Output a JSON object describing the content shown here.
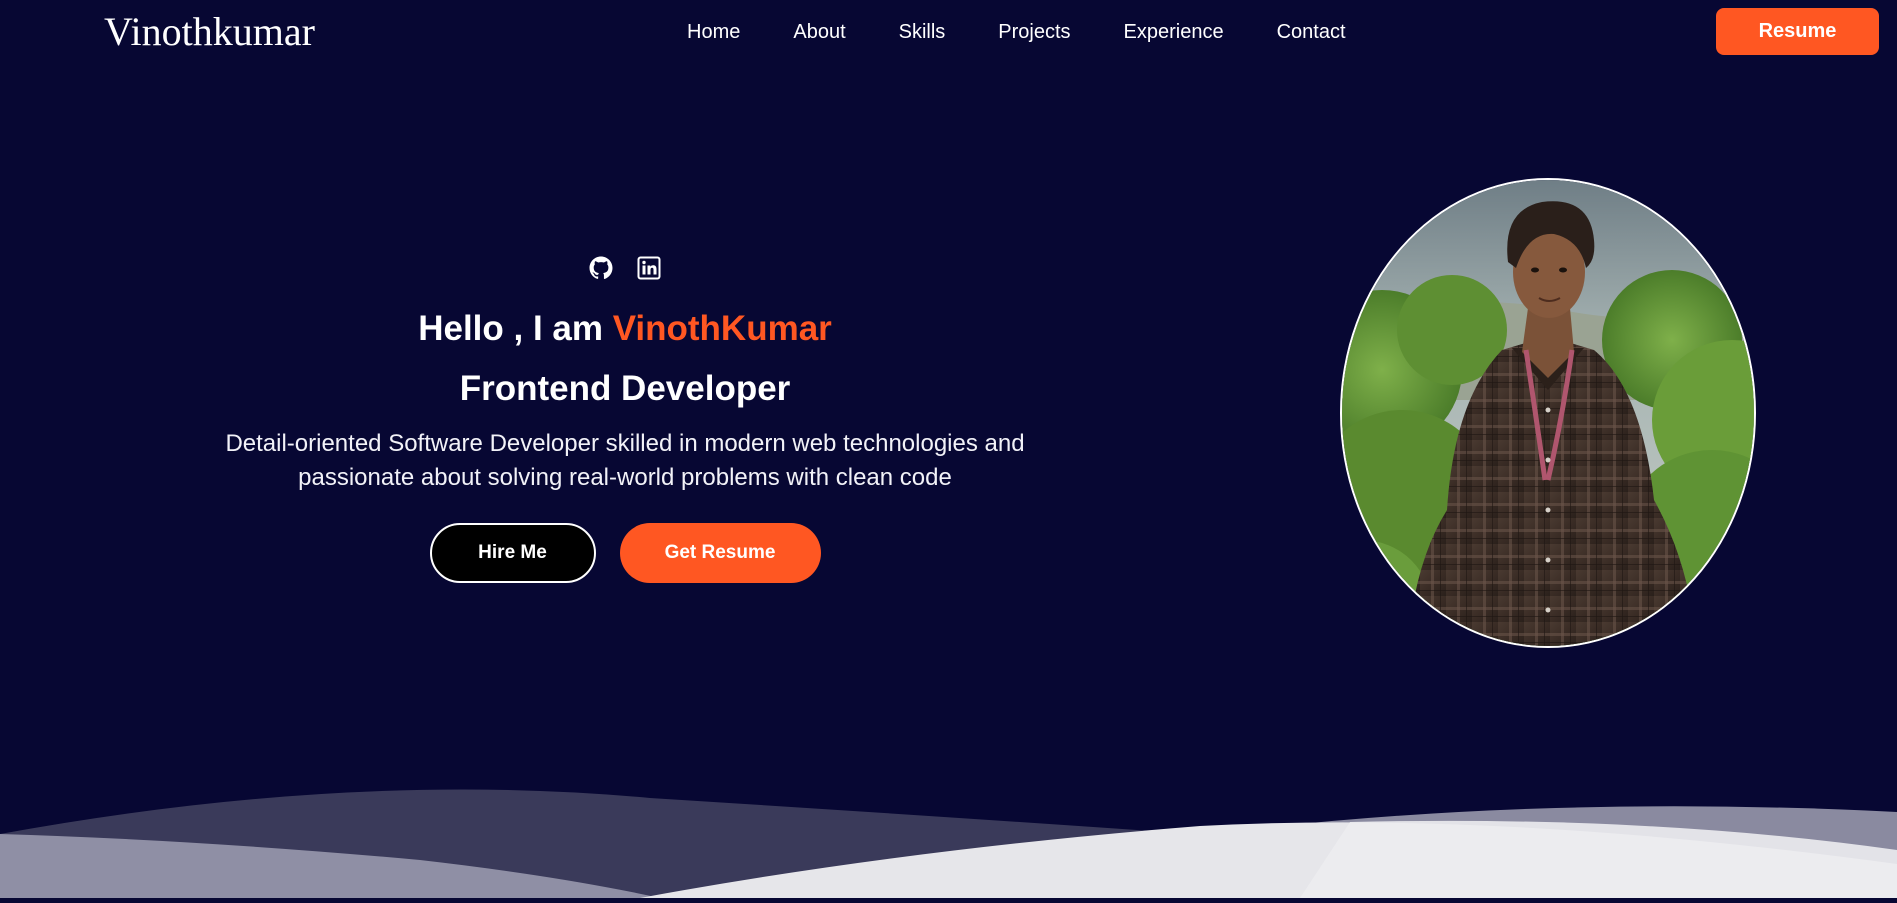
{
  "nav": {
    "logo": "Vinothkumar",
    "links": [
      "Home",
      "About",
      "Skills",
      "Projects",
      "Experience",
      "Contact"
    ],
    "resume_label": "Resume"
  },
  "hero": {
    "social": [
      {
        "icon": "github-icon"
      },
      {
        "icon": "linkedin-icon"
      }
    ],
    "greeting_prefix": "Hello , I am ",
    "name": "VinothKumar",
    "role": "Frontend Developer",
    "description": "Detail-oriented Software Developer skilled in modern web technologies and passionate about solving real-world problems with clean code",
    "hire_label": "Hire Me",
    "get_resume_label": "Get Resume"
  },
  "colors": {
    "background": "#070733",
    "accent": "#ff5722",
    "text": "#ffffff"
  }
}
